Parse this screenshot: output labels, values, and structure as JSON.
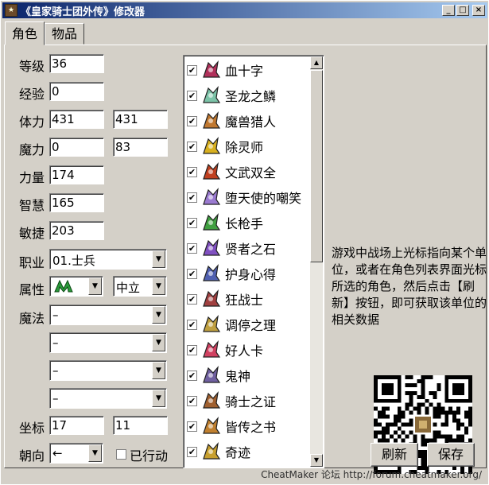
{
  "window": {
    "title": "《皇家骑士团外传》修改器",
    "min": "_",
    "max": "□",
    "close": "×"
  },
  "tabs": [
    {
      "label": "角色"
    },
    {
      "label": "物品"
    }
  ],
  "fields": {
    "level": {
      "label": "等级",
      "value": "36"
    },
    "exp": {
      "label": "经验",
      "value": "0"
    },
    "hp": {
      "label": "体力",
      "value": "431",
      "max": "431"
    },
    "mp": {
      "label": "魔力",
      "value": "0",
      "max": "83"
    },
    "str": {
      "label": "力量",
      "value": "174"
    },
    "int": {
      "label": "智慧",
      "value": "165"
    },
    "agi": {
      "label": "敏捷",
      "value": "203"
    },
    "job": {
      "label": "职业",
      "value": "01.士兵"
    },
    "attr": {
      "label": "属性",
      "icon": "wind-element-icon",
      "alignment": "中立"
    },
    "magic": {
      "label": "魔法",
      "slots": [
        "–",
        "–",
        "–",
        "–"
      ]
    },
    "coord": {
      "label": "坐标",
      "x": "17",
      "y": "11"
    },
    "facing": {
      "label": "朝向",
      "value": "←"
    },
    "acted": {
      "label": "已行动"
    }
  },
  "items": [
    {
      "label": "血十字",
      "icon": "blood-cross-icon",
      "color": "#b0305a"
    },
    {
      "label": "圣龙之鳞",
      "icon": "dragon-scale-icon",
      "color": "#7cc3a8"
    },
    {
      "label": "魔兽猎人",
      "icon": "beast-hunter-icon",
      "color": "#c07830"
    },
    {
      "label": "除灵师",
      "icon": "exorcist-icon",
      "color": "#d8b020"
    },
    {
      "label": "文武双全",
      "icon": "scholar-warrior-icon",
      "color": "#c04020"
    },
    {
      "label": "堕天使的嘲笑",
      "icon": "fallen-angel-icon",
      "color": "#9a7ad0"
    },
    {
      "label": "长枪手",
      "icon": "lancer-icon",
      "color": "#40a040"
    },
    {
      "label": "贤者之石",
      "icon": "sage-stone-icon",
      "color": "#8050c0"
    },
    {
      "label": "护身心得",
      "icon": "protection-icon",
      "color": "#5060b0"
    },
    {
      "label": "狂战士",
      "icon": "berserker-icon",
      "color": "#a04040"
    },
    {
      "label": "调停之理",
      "icon": "mediator-icon",
      "color": "#c0a040"
    },
    {
      "label": "好人卡",
      "icon": "heart-card-icon",
      "color": "#d04060"
    },
    {
      "label": "鬼神",
      "icon": "demon-god-icon",
      "color": "#7060a0"
    },
    {
      "label": "骑士之证",
      "icon": "knight-proof-icon",
      "color": "#a06030"
    },
    {
      "label": "皆传之书",
      "icon": "scroll-book-icon",
      "color": "#c08030"
    },
    {
      "label": "奇迹",
      "icon": "miracle-icon",
      "color": "#c8a030"
    }
  ],
  "hint": "游戏中战场上光标指向某个单位，或者在角色列表界面光标所选的角色，然后点击【刷新】按钮，即可获取该单位的相关数据",
  "buttons": {
    "refresh": "刷新",
    "save": "保存"
  },
  "footer": "CheatMaker 论坛 http://forum.cheatmaker.org/"
}
